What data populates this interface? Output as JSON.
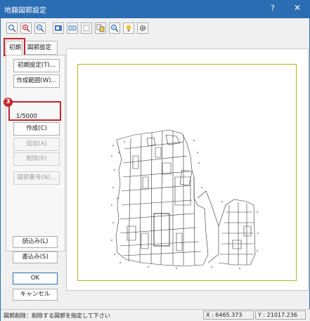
{
  "window": {
    "title": "地籍図郭設定",
    "help_label": "?",
    "close_label": "✕"
  },
  "toolbar": {
    "items": [
      {
        "icon": "zoom-fit-icon",
        "glyph": "⊕"
      },
      {
        "icon": "zoom-in-icon",
        "glyph": "⊕"
      },
      {
        "icon": "zoom-out-icon",
        "glyph": "⊖"
      },
      {
        "icon": "frame-icon",
        "glyph": "▣"
      },
      {
        "icon": "move-icon",
        "glyph": "✥"
      },
      {
        "icon": "range-icon",
        "glyph": "⬚"
      },
      {
        "icon": "copy-frame-icon",
        "glyph": "❐"
      },
      {
        "icon": "search-zoom-icon",
        "glyph": "⌕"
      },
      {
        "icon": "bulb-icon",
        "glyph": "●"
      },
      {
        "icon": "gear-icon",
        "glyph": "⚙"
      }
    ]
  },
  "tabs": {
    "initial": "初期",
    "frame_settings": "図郭設定"
  },
  "panel": {
    "initial_settings_button": "初期設定(T)...",
    "create_range_button": "作成範囲(W)...",
    "scale_label": "1/5000",
    "create_button": "作成(C)",
    "add_button": "追加(A)",
    "delete_button": "削除(R)",
    "frame_number_button": "図郭番号(N)...",
    "step_badge": "3"
  },
  "actions": {
    "load_button": "読込み(L)",
    "save_button": "書込み(S)",
    "ok_button": "OK",
    "cancel_button": "キャンセル"
  },
  "status": {
    "message": "図郭削除：削除する図郭を指定して下さい",
    "x": "X : 6465.373",
    "y": "Y : 21017.236"
  },
  "colors": {
    "accent": "#2b6db3",
    "highlight": "#c1272d",
    "paper_border": "#b5b41a"
  }
}
